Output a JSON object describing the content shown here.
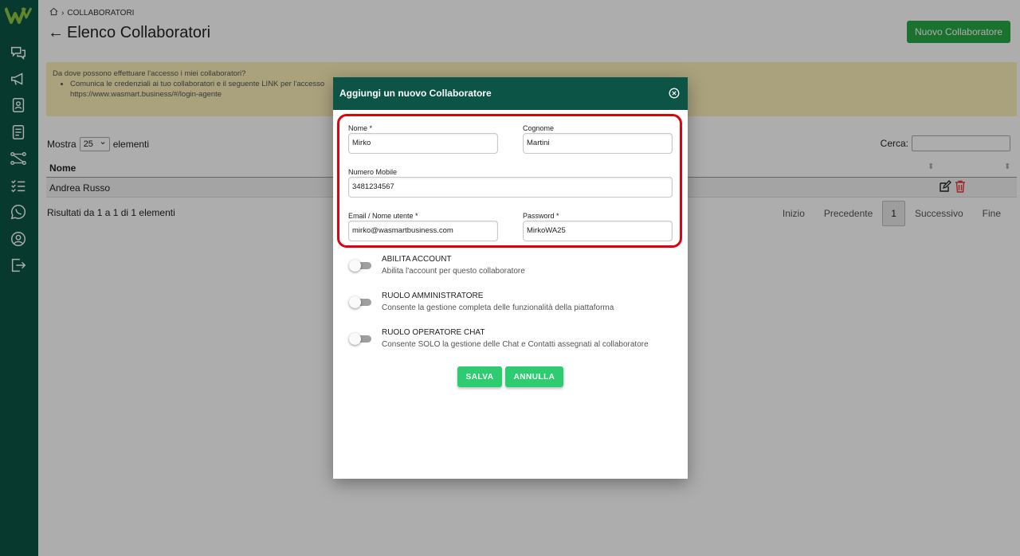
{
  "colors": {
    "sidebar": "#0c5445",
    "primary_button": "#28a745",
    "modal_buttons": "#2ecc71",
    "highlight": "#e2000f",
    "info_box": "#fbeeb8"
  },
  "sidebar": {
    "icons": [
      "logo-icon",
      "chat-icon",
      "megaphone-icon",
      "contacts-icon",
      "document-icon",
      "workflow-icon",
      "checklist-icon",
      "whatsapp-icon",
      "user-icon",
      "logout-icon"
    ]
  },
  "breadcrumb": {
    "current": "COLLABORATORI"
  },
  "page": {
    "title": "Elenco Collaboratori",
    "new_button": "Nuovo Collaboratore"
  },
  "info": {
    "question": "Da dove possono effettuare l'accesso i miei collaboratori?",
    "item": "Comunica le credenziali ai tuo collaboratori e il seguente LINK per l'accesso",
    "link": "https://www.wasmart.business/#/login-agente"
  },
  "table": {
    "show_label": "Mostra",
    "page_length": "25",
    "elements_label": "elementi",
    "search_label": "Cerca:",
    "column_name": "Nome",
    "rows": [
      {
        "name": "Andrea Russo"
      }
    ],
    "result_text": "Risultati da 1 a 1 di 1 elementi",
    "pager": {
      "first": "Inizio",
      "prev": "Precedente",
      "current": "1",
      "next": "Successivo",
      "last": "Fine"
    }
  },
  "modal": {
    "title": "Aggiungi un nuovo Collaboratore",
    "fields": {
      "nome_label": "Nome *",
      "nome_value": "Mirko",
      "cognome_label": "Cognome",
      "cognome_value": "Martini",
      "mobile_label": "Numero Mobile",
      "mobile_value": "3481234567",
      "email_label": "Email / Nome utente *",
      "email_value": "mirko@wasmartbusiness.com",
      "password_label": "Password *",
      "password_value": "MirkoWA25"
    },
    "toggles": [
      {
        "title": "ABILITA ACCOUNT",
        "desc": "Abilita l'account per questo collaboratore",
        "on": false
      },
      {
        "title": "RUOLO AMMINISTRATORE",
        "desc": "Consente la gestione completa delle funzionalità della piattaforma",
        "on": false
      },
      {
        "title": "RUOLO OPERATORE CHAT",
        "desc": "Consente SOLO la gestione delle Chat e Contatti assegnati al collaboratore",
        "on": false
      }
    ],
    "save": "SALVA",
    "cancel": "ANNULLA"
  }
}
